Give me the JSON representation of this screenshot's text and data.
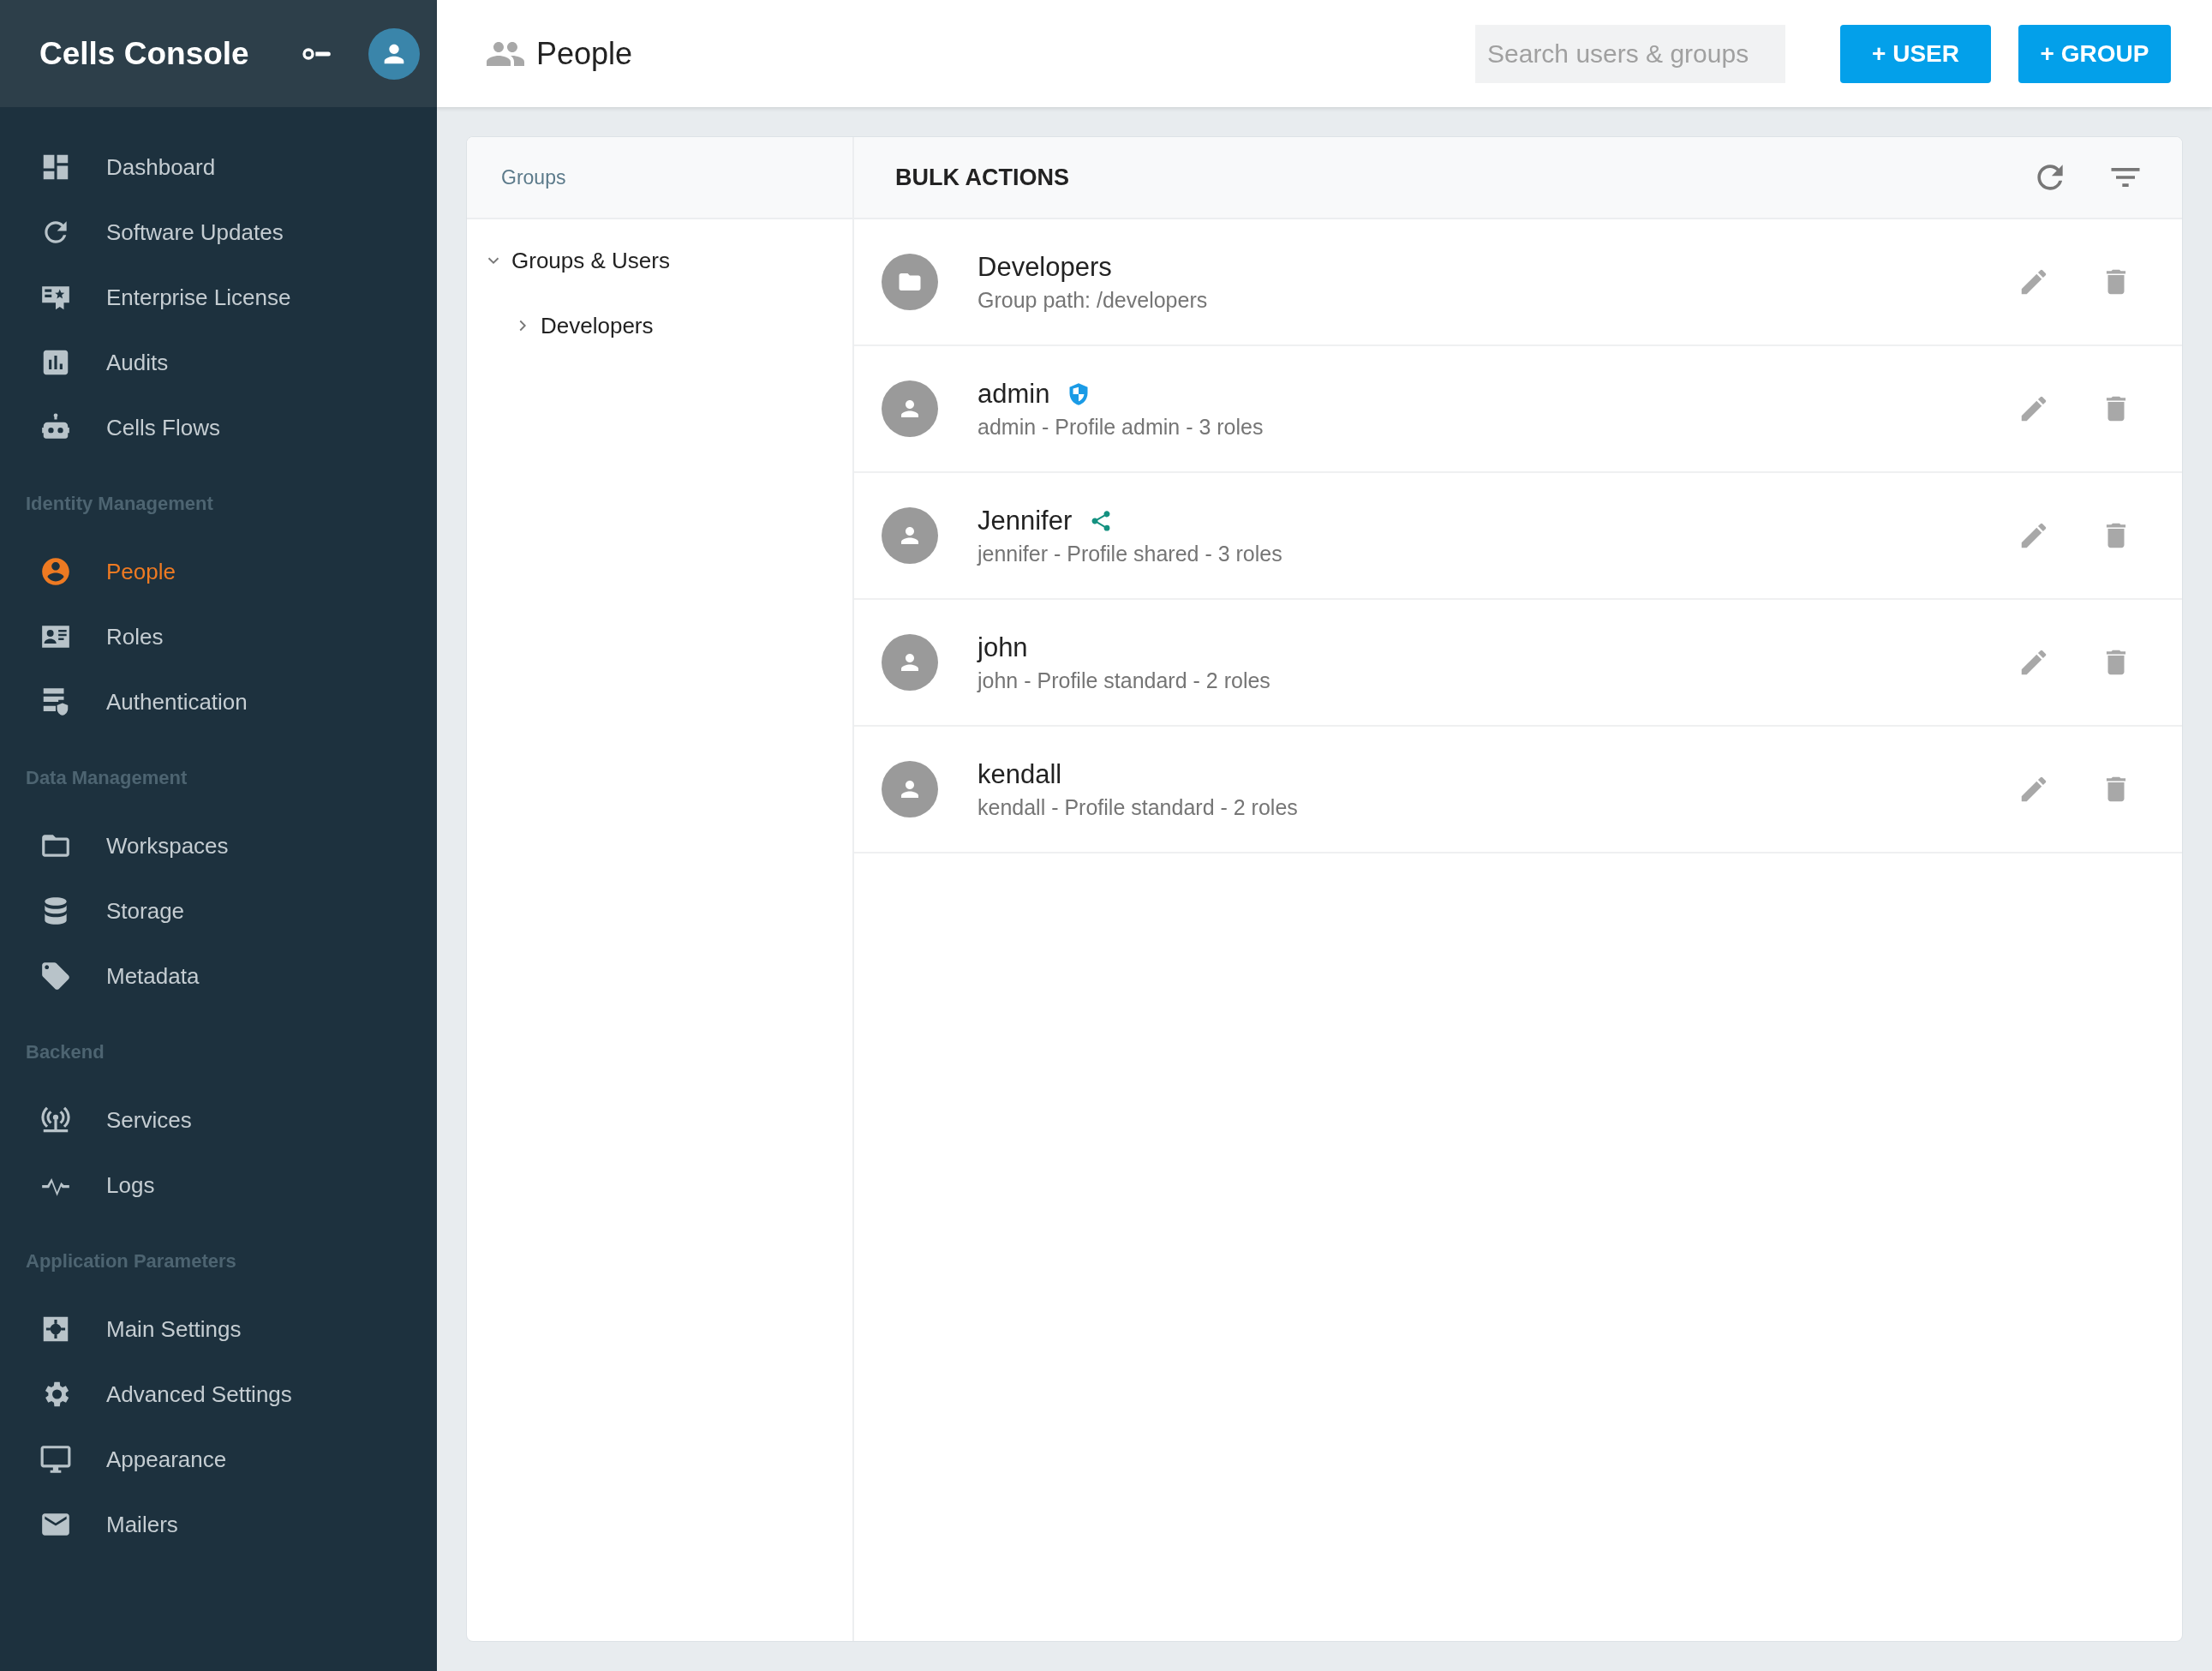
{
  "sidebar": {
    "title": "Cells Console",
    "sections": [
      {
        "items": [
          {
            "label": "Dashboard",
            "selected": false
          },
          {
            "label": "Software Updates",
            "selected": false
          },
          {
            "label": "Enterprise License",
            "selected": false
          },
          {
            "label": "Audits",
            "selected": false
          },
          {
            "label": "Cells Flows",
            "selected": false
          }
        ]
      },
      {
        "title": "Identity Management",
        "items": [
          {
            "label": "People",
            "selected": true
          },
          {
            "label": "Roles",
            "selected": false
          },
          {
            "label": "Authentication",
            "selected": false
          }
        ]
      },
      {
        "title": "Data Management",
        "items": [
          {
            "label": "Workspaces",
            "selected": false
          },
          {
            "label": "Storage",
            "selected": false
          },
          {
            "label": "Metadata",
            "selected": false
          }
        ]
      },
      {
        "title": "Backend",
        "items": [
          {
            "label": "Services",
            "selected": false
          },
          {
            "label": "Logs",
            "selected": false
          }
        ]
      },
      {
        "title": "Application Parameters",
        "items": [
          {
            "label": "Main Settings",
            "selected": false
          },
          {
            "label": "Advanced Settings",
            "selected": false
          },
          {
            "label": "Appearance",
            "selected": false
          },
          {
            "label": "Mailers",
            "selected": false
          }
        ]
      }
    ]
  },
  "header": {
    "title": "People",
    "search": {
      "placeholder": "Search users & groups"
    },
    "buttons": [
      "+ USER",
      "+ GROUP"
    ]
  },
  "groups_panel": {
    "title": "Groups",
    "tree": [
      {
        "label": "Groups & Users",
        "expanded": true,
        "children": [
          {
            "label": "Developers",
            "expanded": false
          }
        ]
      }
    ]
  },
  "list": {
    "title": "BULK ACTIONS",
    "rows": [
      {
        "kind": "group",
        "name": "Developers",
        "detail": "Group path: /developers",
        "admin": false,
        "shared": false
      },
      {
        "kind": "user",
        "name": "admin",
        "detail": "admin - Profile admin - 3 roles",
        "admin": true,
        "shared": false
      },
      {
        "kind": "user",
        "name": "Jennifer",
        "detail": "jennifer - Profile shared - 3 roles",
        "admin": false,
        "shared": true
      },
      {
        "kind": "user",
        "name": "john",
        "detail": "john - Profile standard - 2 roles",
        "admin": false,
        "shared": false
      },
      {
        "kind": "user",
        "name": "kendall",
        "detail": "kendall - Profile standard - 2 roles",
        "admin": false,
        "shared": false
      }
    ]
  }
}
